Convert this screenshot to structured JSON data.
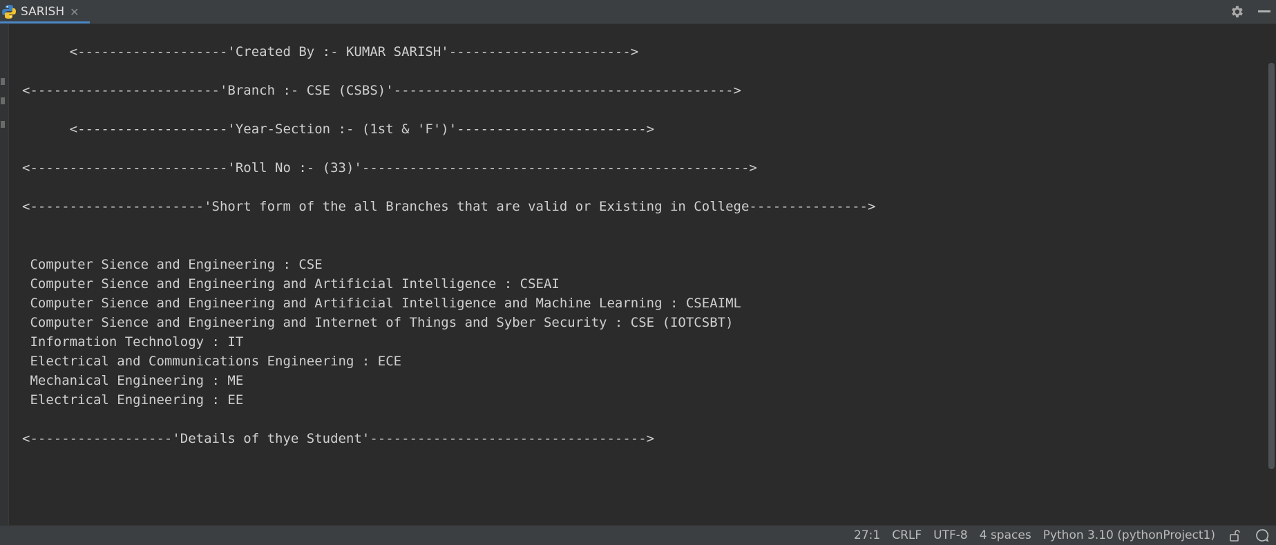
{
  "tab": {
    "label": "SARISH",
    "close": "✕"
  },
  "console_lines": [
    "      <-------------------'Created By :- KUMAR SARISH'----------------------->",
    "",
    "<------------------------'Branch :- CSE (CSBS)'------------------------------------------->",
    "",
    "      <-------------------'Year-Section :- (1st & 'F')'------------------------>",
    "",
    "<-------------------------'Roll No :- (33)'------------------------------------------------->",
    "",
    "<----------------------'Short form of the all Branches that are valid or Existing in College--------------->",
    "",
    "",
    " Computer Sience and Engineering : CSE",
    " Computer Sience and Engineering and Artificial Intelligence : CSEAI",
    " Computer Sience and Engineering and Artificial Intelligence and Machine Learning : CSEAIML",
    " Computer Sience and Engineering and Internet of Things and Syber Security : CSE (IOTCSBT)",
    " Information Technology : IT",
    " Electrical and Communications Engineering : ECE",
    " Mechanical Engineering : ME",
    " Electrical Engineering : EE",
    "",
    "<------------------'Details of thye Student'----------------------------------->"
  ],
  "status": {
    "position": "27:1",
    "line_ending": "CRLF",
    "encoding": "UTF-8",
    "indent": "4 spaces",
    "interpreter": "Python 3.10 (pythonProject1)"
  },
  "icons": {
    "tab": "python-icon",
    "settings": "gear-icon",
    "window": "minimize-icon",
    "lock": "lock-icon",
    "chat": "chat-icon"
  },
  "colors": {
    "accent": "#4a88c7",
    "background": "#2b2b2b",
    "text": "#cfcfcf"
  }
}
